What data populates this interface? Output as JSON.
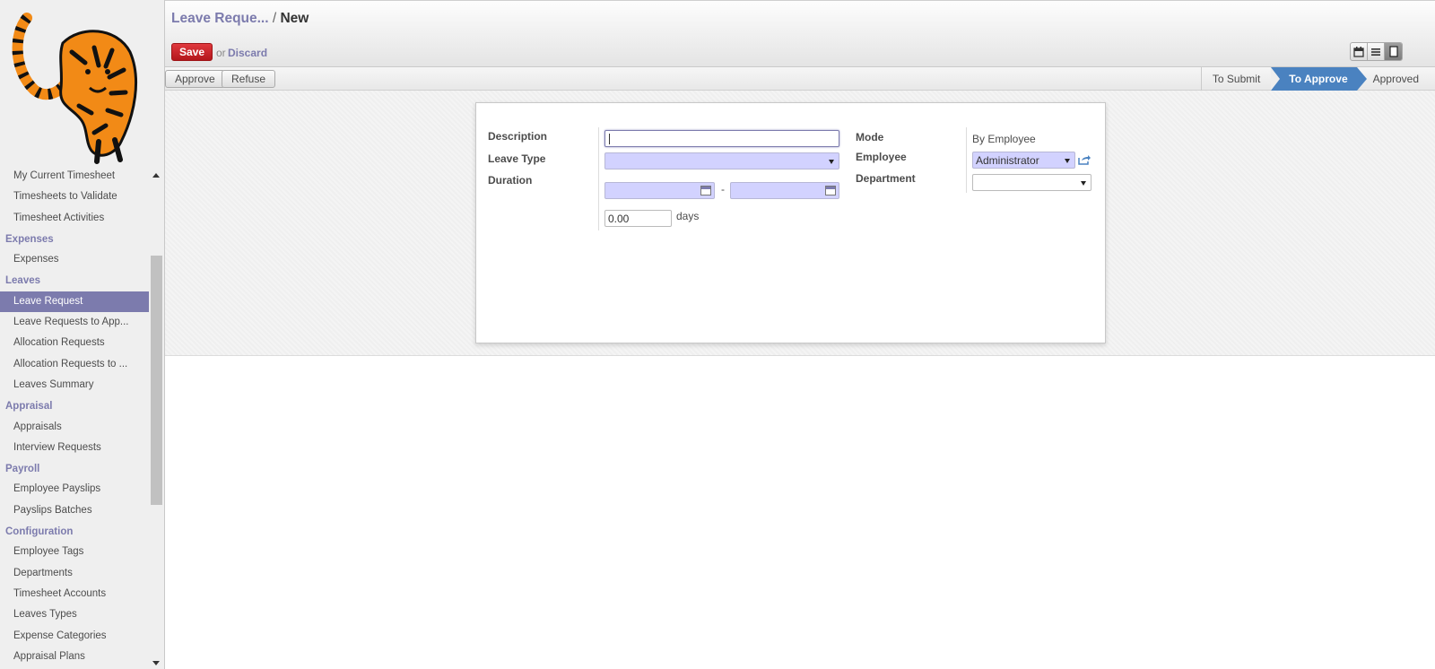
{
  "sidebar": {
    "items": [
      {
        "type": "item",
        "label": "My Current Timesheet"
      },
      {
        "type": "item",
        "label": "Timesheets to Validate"
      },
      {
        "type": "item",
        "label": "Timesheet Activities"
      },
      {
        "type": "section",
        "label": "Expenses"
      },
      {
        "type": "item",
        "label": "Expenses"
      },
      {
        "type": "section",
        "label": "Leaves"
      },
      {
        "type": "item",
        "label": "Leave Request",
        "active": true
      },
      {
        "type": "item",
        "label": "Leave Requests to App..."
      },
      {
        "type": "item",
        "label": "Allocation Requests"
      },
      {
        "type": "item",
        "label": "Allocation Requests to ..."
      },
      {
        "type": "item",
        "label": "Leaves Summary"
      },
      {
        "type": "section",
        "label": "Appraisal"
      },
      {
        "type": "item",
        "label": "Appraisals"
      },
      {
        "type": "item",
        "label": "Interview Requests"
      },
      {
        "type": "section",
        "label": "Payroll"
      },
      {
        "type": "item",
        "label": "Employee Payslips"
      },
      {
        "type": "item",
        "label": "Payslips Batches"
      },
      {
        "type": "section",
        "label": "Configuration"
      },
      {
        "type": "item",
        "label": "Employee Tags"
      },
      {
        "type": "item",
        "label": "Departments"
      },
      {
        "type": "item",
        "label": "Timesheet Accounts"
      },
      {
        "type": "item",
        "label": "Leaves Types"
      },
      {
        "type": "item",
        "label": "Expense Categories"
      },
      {
        "type": "item",
        "label": "Appraisal Plans"
      }
    ]
  },
  "header": {
    "crumb": "Leave Reque...",
    "separator": "/",
    "current": "New",
    "save_label": "Save",
    "or_text": "or",
    "discard_label": "Discard",
    "views": [
      "calendar-view-icon",
      "list-view-icon",
      "form-view-icon"
    ]
  },
  "statusbar": {
    "approve_label": "Approve",
    "refuse_label": "Refuse",
    "stages": [
      "To Submit",
      "To Approve",
      "Approved"
    ],
    "current_stage": "To Approve"
  },
  "form": {
    "description_label": "Description",
    "description_value": "",
    "leave_type_label": "Leave Type",
    "leave_type_value": "",
    "duration_label": "Duration",
    "date_from": "",
    "date_separator": "-",
    "date_to": "",
    "days_value": "0.00",
    "days_unit": "days",
    "mode_label": "Mode",
    "mode_value": "By Employee",
    "employee_label": "Employee",
    "employee_value": "Administrator",
    "department_label": "Department",
    "department_value": ""
  },
  "colors": {
    "accent": "#7c7bad",
    "save": "#c9242a",
    "stage_current": "#4a82c0",
    "required_field": "#d2d2ff"
  }
}
